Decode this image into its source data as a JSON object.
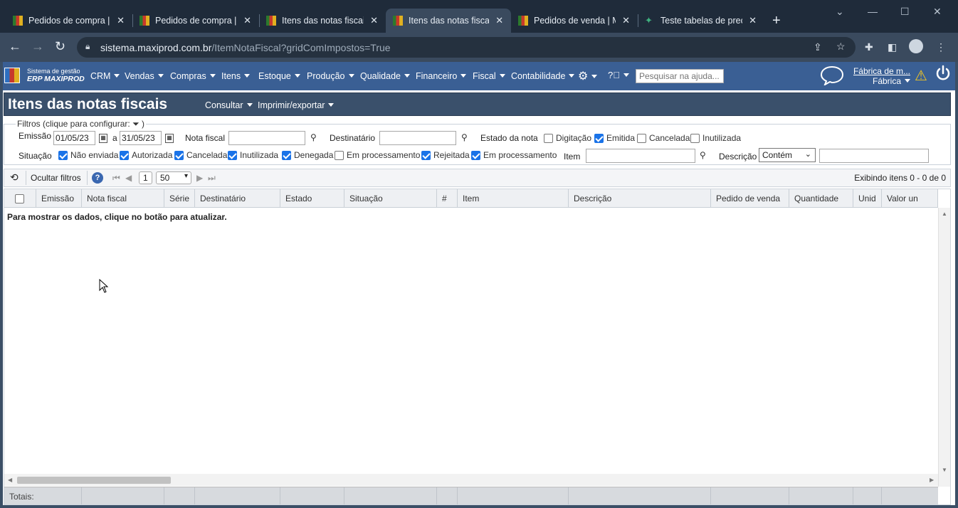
{
  "browser": {
    "tabs": [
      {
        "title": "Pedidos de compra | M",
        "icon": "erp-favicon",
        "active": false
      },
      {
        "title": "Pedidos de compra | M",
        "icon": "erp-favicon",
        "active": false
      },
      {
        "title": "Itens das notas fiscais",
        "icon": "erp-favicon",
        "active": false
      },
      {
        "title": "Itens das notas fiscais",
        "icon": "erp-favicon",
        "active": true
      },
      {
        "title": "Pedidos de venda | M",
        "icon": "erp-favicon",
        "active": false
      },
      {
        "title": "Teste tabelas de preço",
        "icon": "green-favicon",
        "active": false
      }
    ],
    "url_host": "sistema.maxiprod.com.br",
    "url_path": "/ItemNotaFiscal?gridComImpostos=True"
  },
  "app": {
    "logo_line1": "Sistema de gestão",
    "logo_line2": "ERP MAXIPROD",
    "menu": [
      "CRM",
      "Vendas",
      "Compras",
      "Itens",
      "Estoque",
      "Produção",
      "Qualidade",
      "Financeiro",
      "Fiscal",
      "Contabilidade"
    ],
    "help_search_placeholder": "Pesquisar na ajuda...",
    "company_name": "Fábrica de m...",
    "company_unit": "Fábrica"
  },
  "page": {
    "title": "Itens das notas fiscais",
    "menu_consultar": "Consultar",
    "menu_imprimir": "Imprimir/exportar"
  },
  "filters": {
    "legend": "Filtros (clique para configurar:",
    "legend_end": ")",
    "emissao_label": "Emissão",
    "date_from": "01/05/23",
    "date_sep": "a",
    "date_to": "31/05/23",
    "nota_fiscal_label": "Nota fiscal",
    "destinatario_label": "Destinatário",
    "estado_label": "Estado da nota",
    "estado_options": [
      {
        "label": "Digitação",
        "checked": false
      },
      {
        "label": "Emitida",
        "checked": true
      },
      {
        "label": "Cancelada",
        "checked": false
      },
      {
        "label": "Inutilizada",
        "checked": false
      }
    ],
    "situacao_label": "Situação",
    "situacao_options": [
      {
        "label": "Não enviada",
        "checked": true
      },
      {
        "label": "Autorizada",
        "checked": true
      },
      {
        "label": "Cancelada",
        "checked": true
      },
      {
        "label": "Inutilizada",
        "checked": true
      },
      {
        "label": "Denegada",
        "checked": true
      },
      {
        "label": "Em processamento",
        "checked": false
      },
      {
        "label": "Rejeitada",
        "checked": true
      },
      {
        "label": "Em processamento",
        "checked": true
      }
    ],
    "item_label": "Item",
    "descricao_label": "Descrição",
    "descricao_mode": "Contém"
  },
  "toolbar": {
    "hide_filters": "Ocultar filtros",
    "page_number": "1",
    "page_size": "50",
    "showing": "Exibindo itens 0 - 0 de 0"
  },
  "grid": {
    "columns": [
      "Emissão",
      "Nota fiscal",
      "Série",
      "Destinatário",
      "Estado",
      "Situação",
      "#",
      "Item",
      "Descrição",
      "Pedido de venda",
      "Quantidade",
      "Unid",
      "Valor un"
    ],
    "empty_message": "Para mostrar os dados, clique no botão para atualizar.",
    "totals_label": "Totais:"
  }
}
